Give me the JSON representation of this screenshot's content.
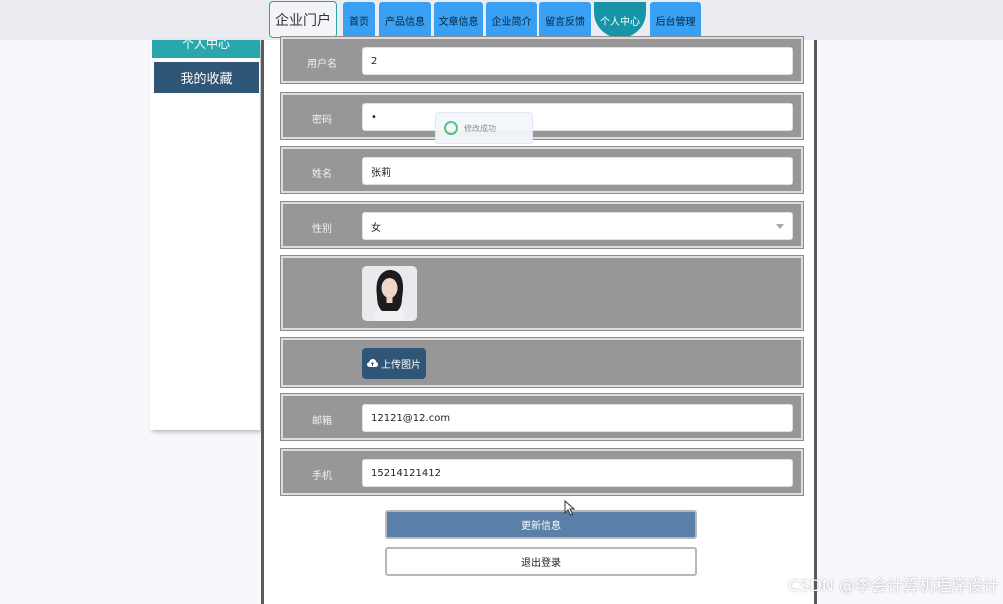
{
  "nav": {
    "brand": "企业门户",
    "items": [
      "首页",
      "产品信息",
      "文章信息",
      "企业简介",
      "留言反馈",
      "个人中心",
      "后台管理"
    ],
    "active": "个人中心"
  },
  "sidebar": {
    "prev_item": "个人中心",
    "item": "我的收藏"
  },
  "form": {
    "username": {
      "label": "用户名",
      "value": "2"
    },
    "password": {
      "label": "密码",
      "value": "•"
    },
    "name": {
      "label": "姓名",
      "value": "张莉"
    },
    "gender": {
      "label": "性别",
      "value": "女"
    },
    "photo_upload_label": "上传图片",
    "email": {
      "label": "邮箱",
      "value": "12121@12.com"
    },
    "phone": {
      "label": "手机",
      "value": "15214121412"
    }
  },
  "buttons": {
    "update": "更新信息",
    "logout": "退出登录"
  },
  "toast": {
    "message": "修改成功"
  },
  "watermark": "CSDN @李会计算机程序设计",
  "colors": {
    "nav_button": "#3aa0f3",
    "nav_active": "#1595a7",
    "side_item": "#2f5577",
    "row_bg": "#979797",
    "update_button": "#5a7fa8"
  }
}
